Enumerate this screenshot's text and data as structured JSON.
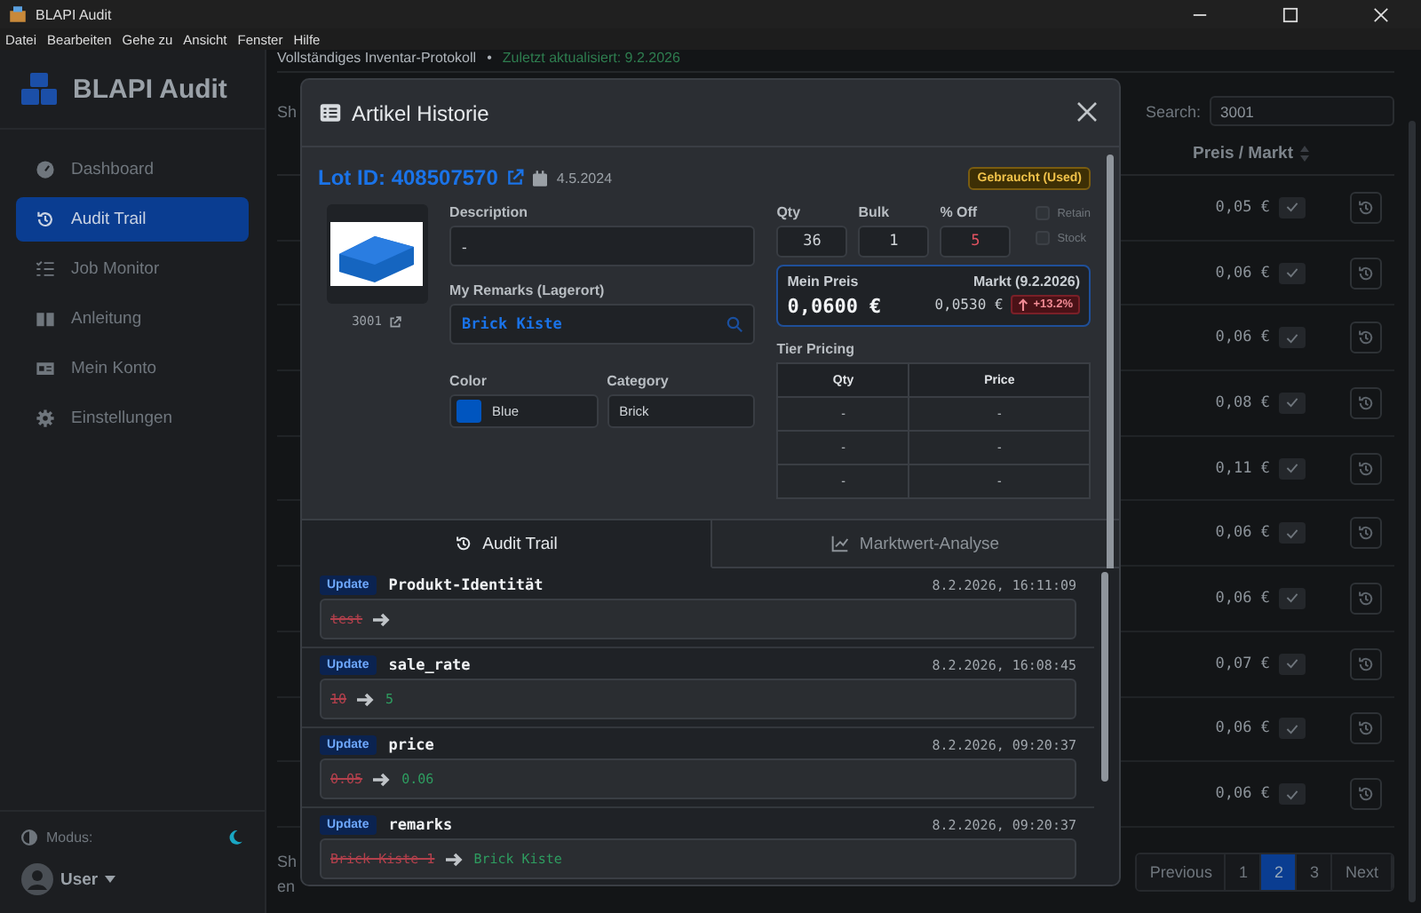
{
  "window": {
    "title": "BLAPI Audit"
  },
  "menu": [
    "Datei",
    "Bearbeiten",
    "Gehe zu",
    "Ansicht",
    "Fenster",
    "Hilfe"
  ],
  "sidebar": {
    "brand": "BLAPI Audit",
    "items": [
      {
        "label": "Dashboard",
        "selected": false
      },
      {
        "label": "Audit Trail",
        "selected": true
      },
      {
        "label": "Job Monitor",
        "selected": false
      },
      {
        "label": "Anleitung",
        "selected": false
      },
      {
        "label": "Mein Konto",
        "selected": false
      },
      {
        "label": "Einstellungen",
        "selected": false
      }
    ],
    "mode_label": "Modus:",
    "user": "User"
  },
  "page": {
    "subtitle": "Vollständiges Inventar-Protokoll",
    "separator": "•",
    "status": "Zuletzt aktualisiert: 9.2.2026",
    "show_top": "Sh",
    "show_bottom": [
      "Sh",
      "en"
    ],
    "search_label": "Search:",
    "search_value": "3001",
    "column": "Preis / Markt",
    "prices": [
      "0,05 €",
      "0,06 €",
      "0,06 €",
      "0,08 €",
      "0,11 €",
      "0,06 €",
      "0,06 €",
      "0,07 €",
      "0,06 €",
      "0,06 €"
    ],
    "pagination": [
      {
        "label": "Previous",
        "selected": false
      },
      {
        "label": "1",
        "selected": false
      },
      {
        "label": "2",
        "selected": true
      },
      {
        "label": "3",
        "selected": false
      },
      {
        "label": "Next",
        "selected": false
      }
    ]
  },
  "modal": {
    "title": "Artikel Historie",
    "lot": "Lot ID: 408507570",
    "date": "4.5.2024",
    "condition": "Gebraucht (Used)",
    "part_no": "3001",
    "description": {
      "label": "Description",
      "value": "-"
    },
    "remarks": {
      "label": "My Remarks (Lagerort)",
      "value": "Brick Kiste"
    },
    "color": {
      "label": "Color",
      "value": "Blue"
    },
    "category": {
      "label": "Category",
      "value": "Brick"
    },
    "numbers": [
      {
        "label": "Qty",
        "value": "36",
        "kind": "plain"
      },
      {
        "label": "Bulk",
        "value": "1",
        "kind": "plain"
      },
      {
        "label": "% Off",
        "value": "5",
        "kind": "discount"
      }
    ],
    "checkboxes": [
      {
        "label": "Retain",
        "checked": false
      },
      {
        "label": "Stock",
        "checked": false
      }
    ],
    "price": {
      "label": "Mein Preis",
      "value": "0,0600 €",
      "market_label": "Markt (9.2.2026)",
      "market_value": "0,0530 €",
      "change": "+13.2%"
    },
    "tier": {
      "title": "Tier Pricing",
      "columns": [
        "Qty",
        "Price"
      ],
      "rows": [
        [
          "-",
          "-"
        ],
        [
          "-",
          "-"
        ],
        [
          "-",
          "-"
        ]
      ]
    },
    "tabs": [
      {
        "label": "Audit Trail",
        "selected": true
      },
      {
        "label": "Marktwert-Analyse",
        "selected": false
      }
    ],
    "entries": [
      {
        "badge": "Update",
        "field": "Produkt-Identität",
        "time": "8.2.2026, 16:11:09",
        "old": "test"
      },
      {
        "badge": "Update",
        "field": "sale_rate",
        "time": "8.2.2026, 16:08:45",
        "old": "10",
        "new": "5"
      },
      {
        "badge": "Update",
        "field": "price",
        "time": "8.2.2026, 09:20:37",
        "old": "0.05",
        "new": "0.06"
      },
      {
        "badge": "Update",
        "field": "remarks",
        "time": "8.2.2026, 09:20:37",
        "old": "Brick Kiste 1",
        "new": "Brick Kiste"
      }
    ]
  }
}
